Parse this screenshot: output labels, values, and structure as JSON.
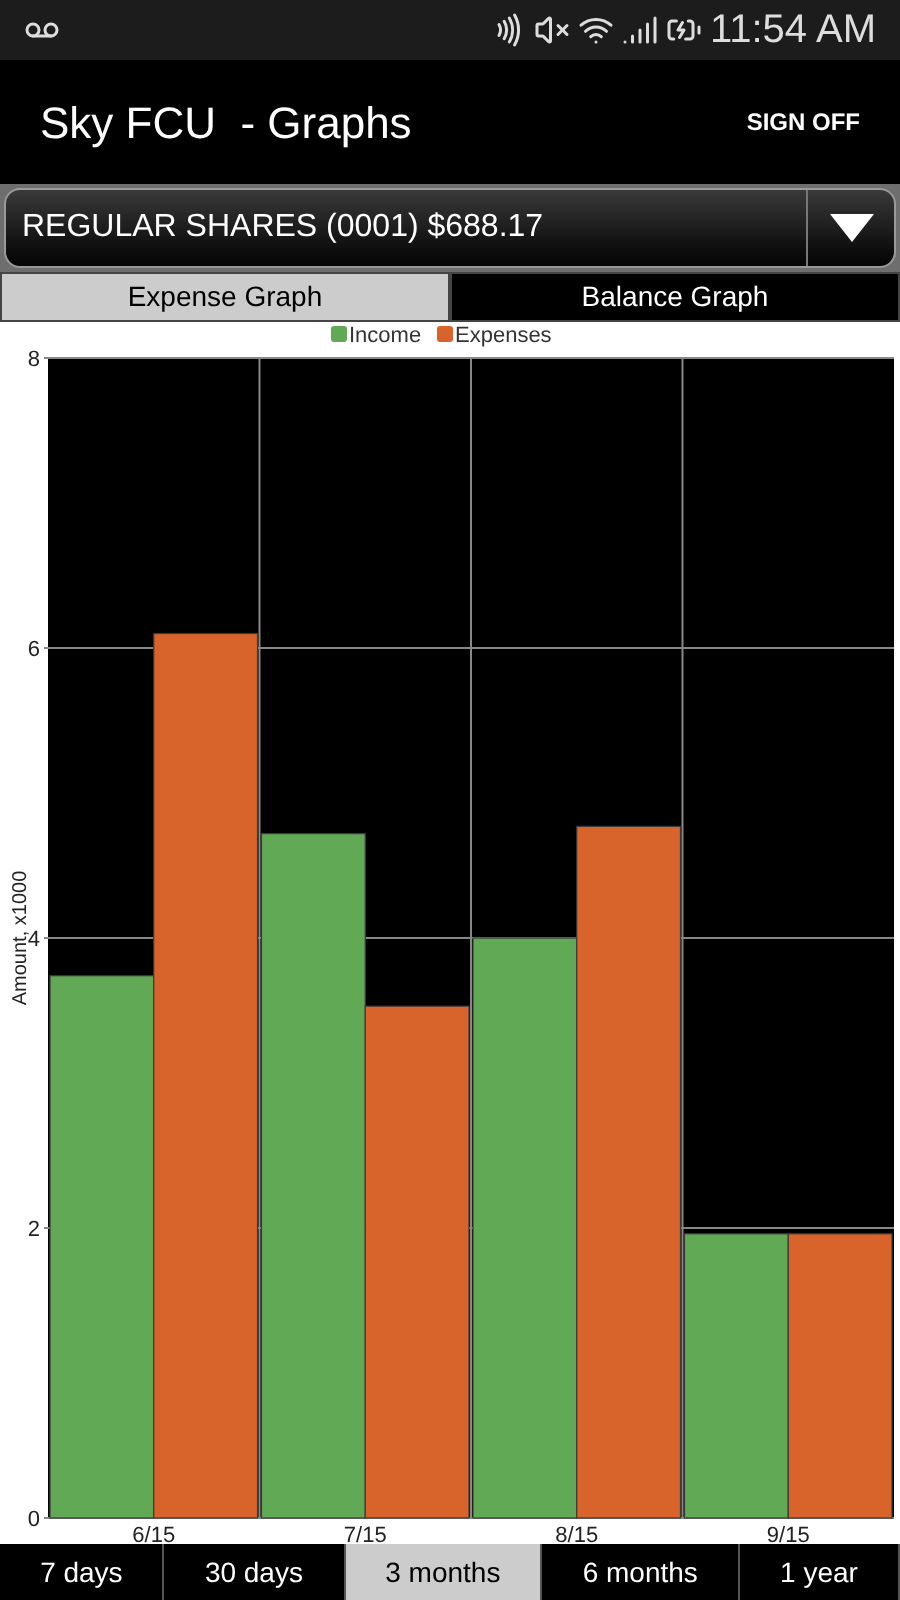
{
  "status_bar": {
    "time": "11:54 AM"
  },
  "header": {
    "title": "Sky FCU  - Graphs",
    "action": "SIGN OFF"
  },
  "account_select": {
    "value": "REGULAR SHARES (0001) $688.17"
  },
  "graph_tabs": [
    {
      "label": "Expense Graph",
      "selected": true
    },
    {
      "label": "Balance Graph",
      "selected": false
    }
  ],
  "chart_data": {
    "type": "bar",
    "ylabel": "Amount, x1000",
    "categories": [
      "6/15",
      "7/15",
      "8/15",
      "9/15"
    ],
    "series": [
      {
        "name": "Income",
        "color": "#62a955",
        "values": [
          3.74,
          4.72,
          4.0,
          1.96
        ]
      },
      {
        "name": "Expenses",
        "color": "#d9642b",
        "values": [
          6.1,
          3.53,
          4.77,
          1.96
        ]
      }
    ],
    "ylim": [
      0,
      8
    ],
    "yticks": [
      0,
      2,
      4,
      6,
      8
    ],
    "grid": true,
    "legend": true
  },
  "range_tabs": [
    {
      "label": "7 days",
      "selected": false
    },
    {
      "label": "30 days",
      "selected": false
    },
    {
      "label": "3 months",
      "selected": true
    },
    {
      "label": "6 months",
      "selected": false
    },
    {
      "label": "1 year",
      "selected": false
    }
  ]
}
